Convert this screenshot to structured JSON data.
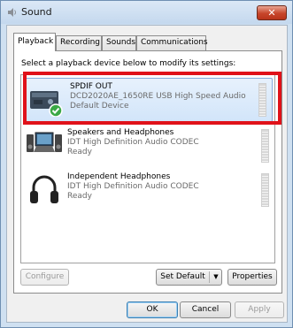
{
  "window": {
    "title": "Sound",
    "close_glyph": "✕"
  },
  "tabs": [
    {
      "label": "Playback",
      "active": true
    },
    {
      "label": "Recording",
      "active": false
    },
    {
      "label": "Sounds",
      "active": false
    },
    {
      "label": "Communications",
      "active": false
    }
  ],
  "instruction": "Select a playback device below to modify its settings:",
  "devices": [
    {
      "name": "SPDIF OUT",
      "desc": "DCD2020AE_1650RE USB High Speed Audio",
      "status": "Default Device",
      "icon": "spdif-device-icon",
      "selected": true,
      "default_badge": "check-icon"
    },
    {
      "name": "Speakers and Headphones",
      "desc": "IDT High Definition Audio CODEC",
      "status": "Ready",
      "icon": "speakers-laptop-icon",
      "selected": false
    },
    {
      "name": "Independent Headphones",
      "desc": "IDT High Definition Audio CODEC",
      "status": "Ready",
      "icon": "headphones-icon",
      "selected": false
    }
  ],
  "buttons": {
    "configure": "Configure",
    "set_default": "Set Default",
    "properties": "Properties",
    "ok": "OK",
    "cancel": "Cancel",
    "apply": "Apply"
  },
  "colors": {
    "highlight": "#e0121a",
    "selection": "#d2e5fa",
    "close": "#c7452a"
  }
}
